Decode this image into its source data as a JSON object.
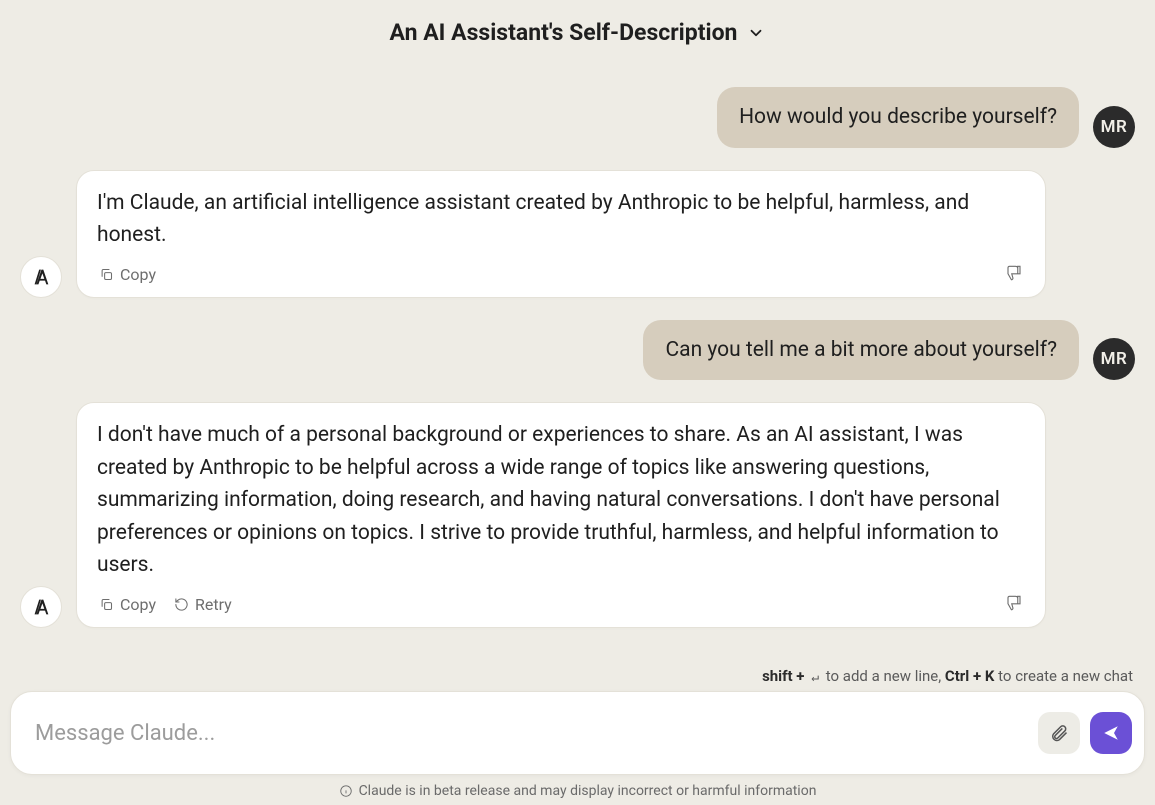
{
  "header": {
    "title": "An AI Assistant's Self-Description"
  },
  "user": {
    "initials": "MR"
  },
  "messages": [
    {
      "role": "user",
      "text": "How would you describe yourself?"
    },
    {
      "role": "ai",
      "text": "I'm Claude, an artificial intelligence assistant created by Anthropic to be helpful, harmless, and honest."
    },
    {
      "role": "user",
      "text": "Can you tell me a bit more about yourself?"
    },
    {
      "role": "ai",
      "text": "I don't have much of a personal background or experiences to share. As an AI assistant, I was created by Anthropic to be helpful across a wide range of topics like answering questions, summarizing information, doing research, and having natural conversations. I don't have personal preferences or opinions on topics. I strive to provide truthful, harmless, and helpful information to users."
    }
  ],
  "actions": {
    "copy": "Copy",
    "retry": "Retry"
  },
  "composer": {
    "placeholder": "Message Claude...",
    "hint_shift": "shift + ",
    "hint_newline": " to add a new line, ",
    "hint_ctrlk": "Ctrl + K",
    "hint_newchat": " to create a new chat"
  },
  "disclaimer": "Claude is in beta release and may display incorrect or harmful information"
}
